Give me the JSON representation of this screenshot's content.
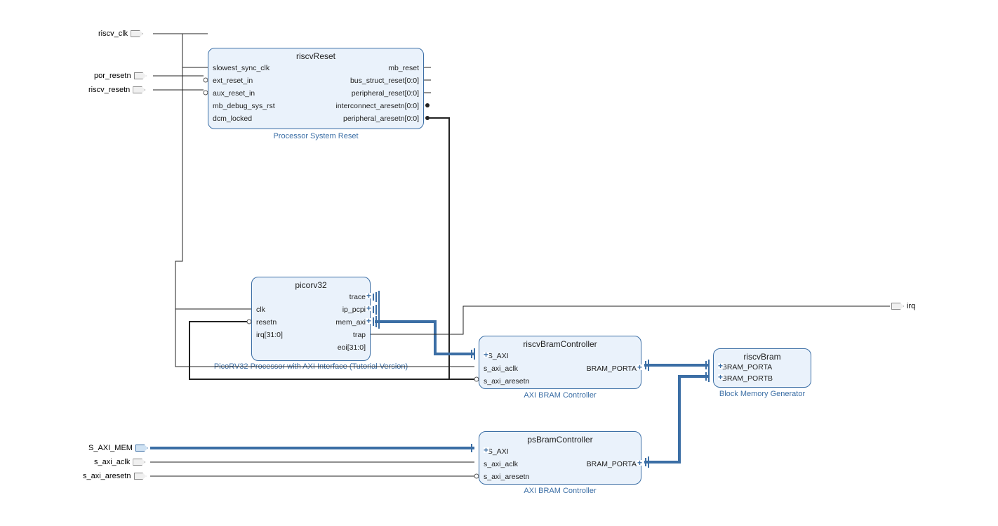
{
  "external_ports": {
    "riscv_clk": "riscv_clk",
    "por_resetn": "por_resetn",
    "riscv_resetn": "riscv_resetn",
    "s_axi_mem": "S_AXI_MEM",
    "s_axi_aclk": "s_axi_aclk",
    "s_axi_aresetn": "s_axi_aresetn",
    "irq": "irq"
  },
  "blocks": {
    "riscvReset": {
      "title": "riscvReset",
      "subtitle": "Processor System Reset",
      "pins_left": [
        "slowest_sync_clk",
        "ext_reset_in",
        "aux_reset_in",
        "mb_debug_sys_rst",
        "dcm_locked"
      ],
      "pins_right": [
        "mb_reset",
        "bus_struct_reset[0:0]",
        "peripheral_reset[0:0]",
        "interconnect_aresetn[0:0]",
        "peripheral_aresetn[0:0]"
      ]
    },
    "picorv32": {
      "title": "picorv32",
      "subtitle": "PicoRV32 Processor with AXI Interface (Tutorial Version)",
      "pins_left": [
        "clk",
        "resetn",
        "irq[31:0]"
      ],
      "pins_right": [
        "trace",
        "ip_pcpi",
        "mem_axi",
        "trap",
        "eoi[31:0]"
      ]
    },
    "riscvBramController": {
      "title": "riscvBramController",
      "subtitle": "AXI BRAM Controller",
      "pins_left": [
        "S_AXI",
        "s_axi_aclk",
        "s_axi_aresetn"
      ],
      "pins_right": [
        "BRAM_PORTA"
      ]
    },
    "psBramController": {
      "title": "psBramController",
      "subtitle": "AXI BRAM Controller",
      "pins_left": [
        "S_AXI",
        "s_axi_aclk",
        "s_axi_aresetn"
      ],
      "pins_right": [
        "BRAM_PORTA"
      ]
    },
    "riscvBram": {
      "title": "riscvBram",
      "subtitle": "Block Memory Generator",
      "pins_left": [
        "BRAM_PORTA",
        "BRAM_PORTB"
      ]
    }
  }
}
